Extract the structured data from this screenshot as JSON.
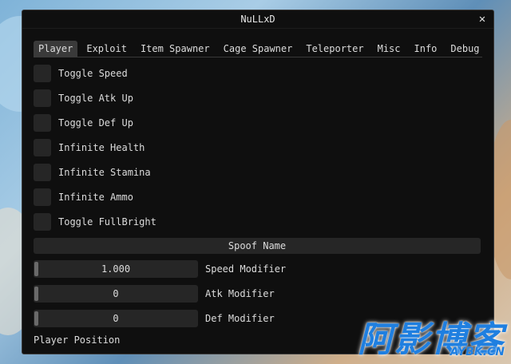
{
  "window": {
    "title": "NuLLxD",
    "close_glyph": "✕"
  },
  "tabs": [
    {
      "label": "Player",
      "active": true
    },
    {
      "label": "Exploit"
    },
    {
      "label": "Item Spawner"
    },
    {
      "label": "Cage Spawner"
    },
    {
      "label": "Teleporter"
    },
    {
      "label": "Misc"
    },
    {
      "label": "Info"
    },
    {
      "label": "Debug"
    }
  ],
  "toggles": [
    {
      "label": "Toggle Speed",
      "checked": false
    },
    {
      "label": "Toggle Atk Up",
      "checked": false
    },
    {
      "label": "Toggle Def Up",
      "checked": false
    },
    {
      "label": "Infinite Health",
      "checked": false
    },
    {
      "label": "Infinite Stamina",
      "checked": false
    },
    {
      "label": "Infinite Ammo",
      "checked": false
    },
    {
      "label": "Toggle FullBright",
      "checked": false
    }
  ],
  "spoof_button": {
    "label": "Spoof Name"
  },
  "sliders": [
    {
      "label": "Speed Modifier",
      "value": "1.000"
    },
    {
      "label": "Atk Modifier",
      "value": "0"
    },
    {
      "label": "Def Modifier",
      "value": "0"
    }
  ],
  "section": {
    "player_position": "Player Position"
  },
  "watermark": {
    "main": "阿影博客",
    "sub": "AYBK.CN"
  },
  "colors": {
    "window_bg": "#0f0f0f",
    "control_bg": "#262626",
    "active_tab": "#3a3a3a",
    "watermark": "#1f7fe0"
  }
}
